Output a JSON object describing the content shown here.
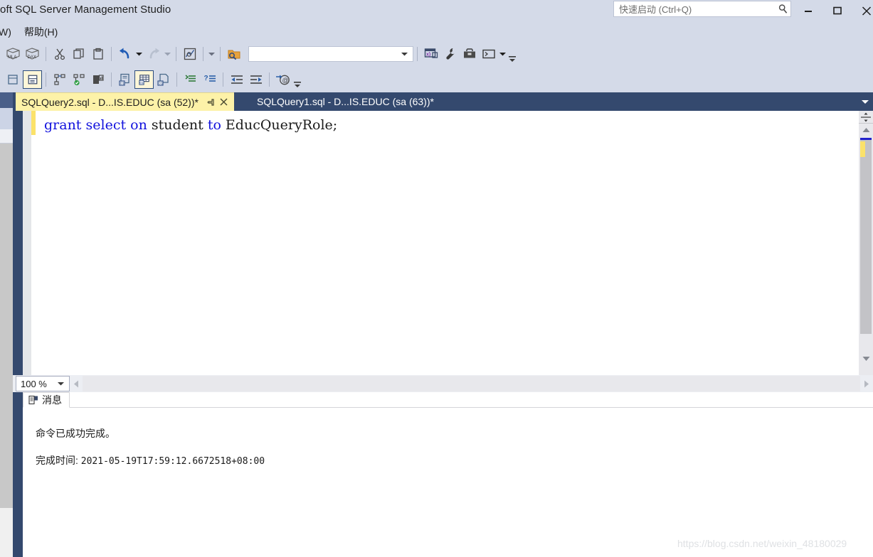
{
  "window": {
    "title": "oft SQL Server Management Studio",
    "quick_launch_placeholder": "快速启动 (Ctrl+Q)",
    "controls": {
      "minimize": "minimize",
      "maximize": "maximize",
      "close": "close"
    }
  },
  "menubar": {
    "items": [
      {
        "label": "W)"
      },
      {
        "label": "帮助(H)"
      }
    ]
  },
  "toolbar": {
    "row1": [
      {
        "name": "mla-query-icon",
        "kind": "icon"
      },
      {
        "name": "dax-query-icon",
        "kind": "icon"
      },
      {
        "name": "separator",
        "kind": "sep"
      },
      {
        "name": "cut-icon",
        "kind": "icon"
      },
      {
        "name": "copy-icon",
        "kind": "icon"
      },
      {
        "name": "paste-icon",
        "kind": "icon"
      },
      {
        "name": "separator",
        "kind": "sep"
      },
      {
        "name": "undo-icon",
        "kind": "icon"
      },
      {
        "name": "undo-dropdown-icon",
        "kind": "drop"
      },
      {
        "name": "redo-icon",
        "kind": "icon"
      },
      {
        "name": "redo-dropdown-icon",
        "kind": "drop"
      },
      {
        "name": "separator",
        "kind": "sep"
      },
      {
        "name": "execution-plan-icon",
        "kind": "icon"
      },
      {
        "name": "separator",
        "kind": "sep"
      },
      {
        "name": "toolbar-dropdown-icon",
        "kind": "drop"
      },
      {
        "name": "separator",
        "kind": "sep"
      },
      {
        "name": "find-in-files-icon",
        "kind": "icon"
      }
    ],
    "combo_value": "",
    "row1_right": [
      {
        "name": "object-explorer-icon",
        "kind": "icon"
      },
      {
        "name": "properties-wrench-icon",
        "kind": "icon"
      },
      {
        "name": "toolbox-icon",
        "kind": "icon"
      },
      {
        "name": "console-icon",
        "kind": "icon"
      },
      {
        "name": "console-dropdown-icon",
        "kind": "drop"
      },
      {
        "name": "toolbar-overflow-icon",
        "kind": "overflow"
      }
    ],
    "row2": [
      {
        "name": "results-to-grid-icon",
        "kind": "icon",
        "selected": false
      },
      {
        "name": "results-to-text-icon",
        "kind": "icon",
        "selected": true
      },
      {
        "name": "separator",
        "kind": "sep"
      },
      {
        "name": "include-actual-plan-icon",
        "kind": "icon"
      },
      {
        "name": "include-live-plan-icon",
        "kind": "icon"
      },
      {
        "name": "include-client-statistics-icon",
        "kind": "icon"
      },
      {
        "name": "separator",
        "kind": "sep"
      },
      {
        "name": "results-to-file-icon",
        "kind": "icon"
      },
      {
        "name": "results-to-grid2-icon",
        "kind": "icon",
        "selected": true
      },
      {
        "name": "results-to-file2-icon",
        "kind": "icon"
      },
      {
        "name": "separator",
        "kind": "sep"
      },
      {
        "name": "comment-lines-icon",
        "kind": "icon"
      },
      {
        "name": "uncomment-lines-icon",
        "kind": "icon"
      },
      {
        "name": "separator",
        "kind": "sep"
      },
      {
        "name": "decrease-indent-icon",
        "kind": "icon"
      },
      {
        "name": "increase-indent-icon",
        "kind": "icon"
      },
      {
        "name": "separator",
        "kind": "sep"
      },
      {
        "name": "specify-values-icon",
        "kind": "icon"
      },
      {
        "name": "toolbar-overflow-icon",
        "kind": "overflow"
      }
    ]
  },
  "tabs": [
    {
      "label": "SQLQuery2.sql - D...IS.EDUC (sa (52))*",
      "active": true,
      "pin_icon": "pin-icon",
      "close_icon": "close-icon"
    },
    {
      "label": "SQLQuery1.sql - D...IS.EDUC (sa (63))*",
      "active": false
    }
  ],
  "editor": {
    "code_tokens": [
      {
        "text": "grant",
        "type": "keyword"
      },
      {
        "text": " ",
        "type": "plain"
      },
      {
        "text": "select",
        "type": "keyword"
      },
      {
        "text": " ",
        "type": "plain"
      },
      {
        "text": "on",
        "type": "keyword"
      },
      {
        "text": " student ",
        "type": "identifier"
      },
      {
        "text": "to",
        "type": "keyword"
      },
      {
        "text": " EducQueryRole;",
        "type": "identifier"
      }
    ],
    "zoom_level": "100 %"
  },
  "results": {
    "tab_label": "消息",
    "tab_icon": "messages-icon",
    "lines": [
      "命令已成功完成。",
      "完成时间: 2021-05-19T17:59:12.6672518+08:00"
    ],
    "line2_prefix": "完成时间: ",
    "line2_value": "2021-05-19T17:59:12.6672518+08:00"
  },
  "watermark": {
    "text": "https://blog.csdn.net/weixin_48180029"
  },
  "colors": {
    "chrome": "#d4dae8",
    "dock_dark": "#34496e",
    "active_tab": "#fdf2a8",
    "keyword": "#1111dd",
    "change_bar": "#fbe26a"
  }
}
